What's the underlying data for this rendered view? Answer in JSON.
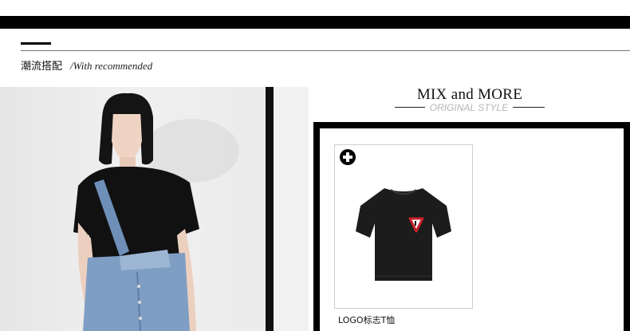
{
  "section": {
    "title_cn": "潮流搭配",
    "title_en": "/With recommended"
  },
  "mix": {
    "title": "MIX and MORE",
    "subtitle": "ORIGINAL STYLE"
  },
  "product": {
    "name": "LOGO标志T恤",
    "add_icon": "plus-circle-icon"
  }
}
